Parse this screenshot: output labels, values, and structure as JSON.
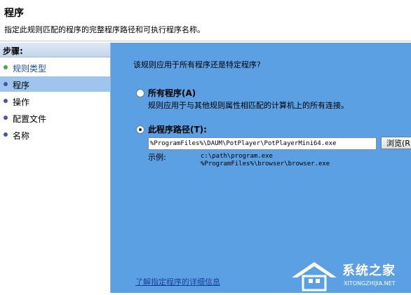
{
  "header": {
    "title": "程序",
    "description": "指定此规则匹配的程序的完整程序路径和可执行程序名称。"
  },
  "sidebar": {
    "steps_title": "步骤:",
    "items": [
      {
        "label": "规则类型",
        "state": "done"
      },
      {
        "label": "程序",
        "state": "active"
      },
      {
        "label": "操作",
        "state": "pending"
      },
      {
        "label": "配置文件",
        "state": "pending"
      },
      {
        "label": "名称",
        "state": "pending"
      }
    ]
  },
  "main": {
    "question": "该规则应用于所有程序还是特定程序?",
    "option_all": {
      "label": "所有程序(A)",
      "description": "规则应用于与其他规则属性相匹配的计算机上的所有连接。",
      "checked": false
    },
    "option_path": {
      "label": "此程序路径(T):",
      "checked": true,
      "value": "%ProgramFiles%\\DAUM\\PotPlayer\\PotPlayerMini64.exe",
      "browse_label": "浏览(R)..."
    },
    "example": {
      "label": "示例:",
      "lines": [
        "c:\\path\\program.exe",
        "%ProgramFiles%\\browser\\browser.exe"
      ]
    },
    "learn_more_link": "了解指定程序的详细信息"
  },
  "watermark": {
    "text": "系统之家",
    "sub": "XITONGZHIJIA.NET"
  },
  "colors": {
    "content_bg": "#5aa0e2",
    "active_step_bg": "#9ec5ee",
    "link": "#1a3f9c"
  }
}
